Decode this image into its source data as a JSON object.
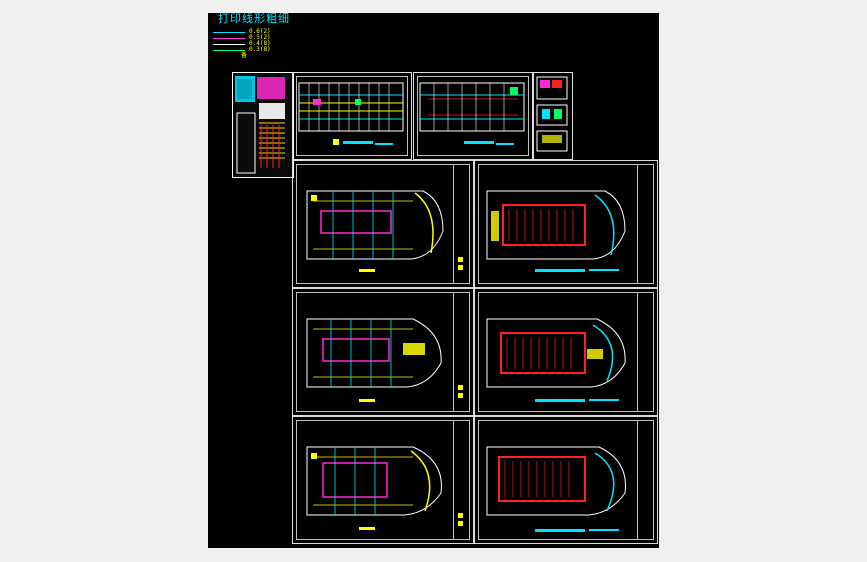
{
  "legend": {
    "title": "打印线形粗细",
    "lines": [
      {
        "label": "0.6(2)",
        "color": "#00e5ff"
      },
      {
        "label": "0.5(2)",
        "color": "#ff2bd6"
      },
      {
        "label": "0.4(8)",
        "color": "#ffffff"
      },
      {
        "label": "0.3(8)",
        "color": "#00ff66"
      }
    ],
    "extra_label": "备"
  },
  "colors": {
    "background": "#000000",
    "frame": "#dcdcdc",
    "wall": "#ffffff",
    "cyan": "#00e5ff",
    "magenta": "#ff2bd6",
    "yellow": "#ffff00",
    "red": "#ff2020",
    "green": "#00ff66"
  }
}
